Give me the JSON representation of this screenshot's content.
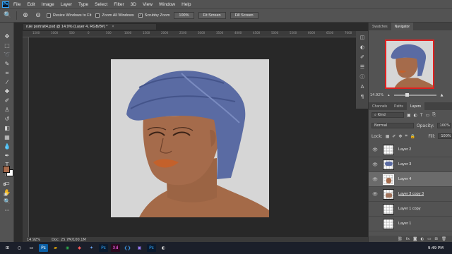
{
  "menubar": {
    "logo": "Ps",
    "items": [
      "File",
      "Edit",
      "Image",
      "Layer",
      "Type",
      "Select",
      "Filter",
      "3D",
      "View",
      "Window",
      "Help"
    ]
  },
  "options": {
    "resize_windows": "Resize Windows to Fit",
    "zoom_all": "Zoom All Windows",
    "scrubby_zoom": "Scrubby Zoom",
    "zoom_value": "100%",
    "fit_screen": "Fit Screen",
    "fill_screen": "Fill Screen"
  },
  "document": {
    "tab_title": "rule portrait4.psd @ 14.9% (Layer 4, RGB/8#) *",
    "close_glyph": "×"
  },
  "status": {
    "zoom": "14.92%",
    "doc": "Doc: 25.7M/100.1M"
  },
  "ruler_ticks": [
    "1500",
    "1000",
    "500",
    "0",
    "500",
    "1000",
    "1500",
    "2000",
    "2500",
    "3000",
    "3500",
    "4000",
    "4500",
    "5000",
    "5500",
    "6000",
    "6500",
    "7000"
  ],
  "right_tabs_top": {
    "swatches": "Swatches",
    "navigator": "Navigator"
  },
  "navigator": {
    "zoom": "14.92%"
  },
  "right_tabs_mid": {
    "channels": "Channels",
    "paths": "Paths",
    "layers": "Layers"
  },
  "layers_panel": {
    "filter": "Kind",
    "blend_mode": "Normal",
    "opacity_label": "Opacity:",
    "opacity_value": "100%",
    "lock_label": "Lock:",
    "fill_label": "Fill:",
    "fill_value": "100%",
    "layers": [
      {
        "name": "Layer 2",
        "visible": true,
        "selected": false,
        "underline": false
      },
      {
        "name": "Layer 3",
        "visible": true,
        "selected": false,
        "underline": false
      },
      {
        "name": "Layer 4",
        "visible": true,
        "selected": true,
        "underline": false
      },
      {
        "name": "Layer 3 copy 3",
        "visible": true,
        "selected": false,
        "underline": true
      },
      {
        "name": "Layer 1 copy",
        "visible": false,
        "selected": false,
        "underline": false
      },
      {
        "name": "Layer 1",
        "visible": false,
        "selected": false,
        "underline": false
      }
    ]
  },
  "colors": {
    "foreground": "#a86b4c",
    "background": "#ffffff",
    "accent": "#31a8ff",
    "nav_frame": "#e02020"
  },
  "clock": {
    "time": "9:49 PM"
  }
}
